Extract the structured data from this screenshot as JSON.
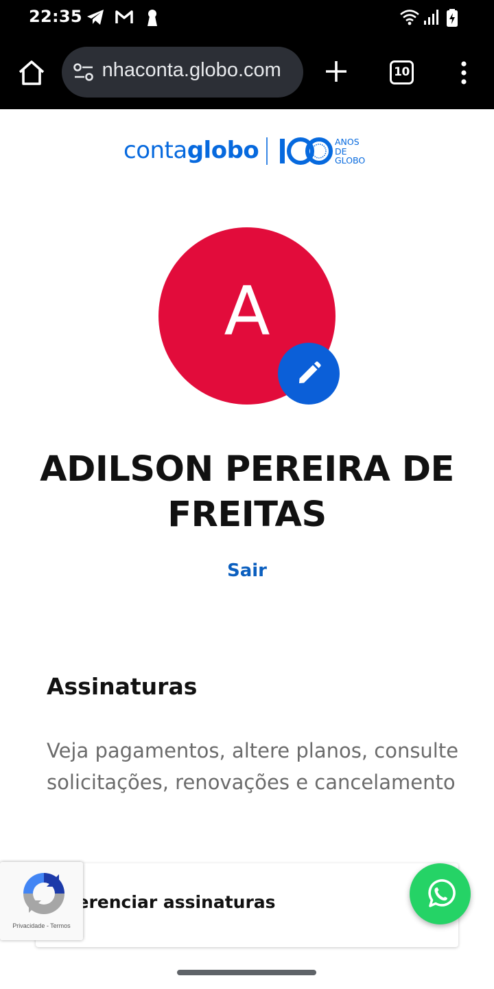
{
  "status_bar": {
    "time": "22:35",
    "icons": [
      "telegram-icon",
      "gmail-icon",
      "keyhole-icon",
      "wifi-icon",
      "signal-icon",
      "battery-charging-icon"
    ]
  },
  "browser": {
    "url": "minhaconta.globo.com",
    "tab_count": "10",
    "icons": [
      "home-icon",
      "site-settings-icon",
      "new-tab-plus-icon",
      "tab-switcher-icon",
      "more-vert-icon"
    ]
  },
  "header": {
    "logo_conta": "conta",
    "logo_globo": "globo",
    "logo_100": "100",
    "logo_anos_line1": "ANOS",
    "logo_anos_line2": "DE",
    "logo_anos_line3": "GLOBO"
  },
  "profile": {
    "initial": "A",
    "avatar_color": "#e20c3b",
    "name": "ADILSON PEREIRA DE FREITAS",
    "logout_label": "Sair"
  },
  "subscriptions": {
    "title": "Assinaturas",
    "description": "Veja pagamentos, altere planos, consulte solicitações, renovações e cancelamento",
    "manage_label": "Gerenciar assinaturas"
  },
  "recaptcha": {
    "privacy": "Privacidade",
    "separator": " - ",
    "terms": "Termos"
  },
  "colors": {
    "brand_blue": "#0669de",
    "whatsapp_green": "#25d366",
    "edit_blue": "#0b5fd8"
  }
}
